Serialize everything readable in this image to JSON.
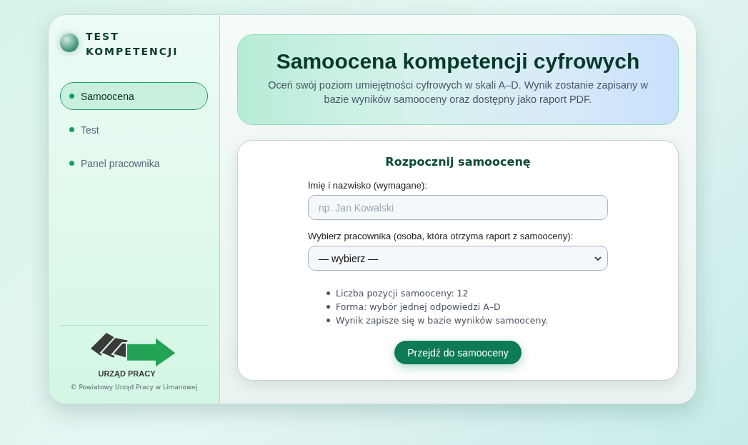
{
  "brand": {
    "title_lines": [
      "TEST",
      "KOMPETENCJI"
    ]
  },
  "sidebar": {
    "items": [
      {
        "label": "Samoocena",
        "selected": true
      },
      {
        "label": "Test",
        "selected": false
      },
      {
        "label": "Panel pracownika",
        "selected": false
      }
    ],
    "logo_text": "URZĄD PRACY",
    "footer": "© Powiatowy Urząd Pracy w Limanowej"
  },
  "hero": {
    "title": "Samoocena kompetencji cyfrowych",
    "subtitle": "Oceń swój poziom umiejętności cyfrowych w skali A–D. Wynik zostanie zapisany w bazie wyników samooceny oraz dostępny jako raport PDF."
  },
  "form": {
    "title": "Rozpocznij samoocenę",
    "name_label": "Imię i nazwisko (wymagane):",
    "name_placeholder": "np. Jan Kowalski",
    "employee_label": "Wybierz pracownika (osoba, która otrzyma raport z samooceny):",
    "employee_value": "— wybierz —",
    "info": [
      "Liczba pozycji samooceny: 12",
      "Forma: wybór jednej odpowiedzi A–D",
      "Wynik zapisze się w bazie wyników samooceny."
    ],
    "submit": "Przejdź do samooceny"
  }
}
